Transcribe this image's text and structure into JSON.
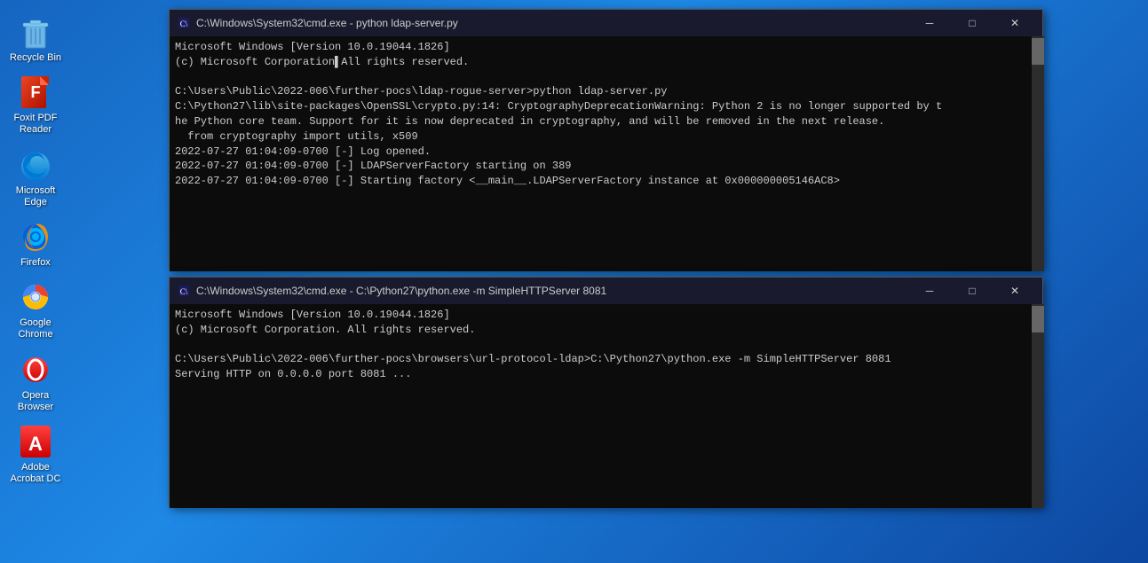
{
  "desktop": {
    "icons": [
      {
        "id": "recycle-bin",
        "label": "Recycle Bin",
        "type": "recycle"
      },
      {
        "id": "foxit-pdf",
        "label": "Foxit PDF\nReader",
        "label_line1": "Foxit PDF",
        "label_line2": "Reader",
        "type": "foxit"
      },
      {
        "id": "microsoft-edge",
        "label": "Microsoft\nEdge",
        "label_line1": "Microsoft",
        "label_line2": "Edge",
        "type": "edge"
      },
      {
        "id": "firefox",
        "label": "Firefox",
        "type": "firefox"
      },
      {
        "id": "google-chrome",
        "label": "Google\nChrome",
        "label_line1": "Google",
        "label_line2": "Chrome",
        "type": "chrome"
      },
      {
        "id": "opera-browser",
        "label": "Opera\nBrowser",
        "label_line1": "Opera",
        "label_line2": "Browser",
        "type": "opera"
      },
      {
        "id": "adobe-acrobat",
        "label": "Adobe\nAcrobat DC",
        "label_line1": "Adobe",
        "label_line2": "Acrobat DC",
        "type": "adobe"
      }
    ]
  },
  "cmd_window1": {
    "title": "C:\\Windows\\System32\\cmd.exe - python  ldap-server.py",
    "lines": [
      "Microsoft Windows [Version 10.0.19044.1826]",
      "(c) Microsoft Corporation. All rights reserved.",
      "",
      "C:\\Users\\Public\\2022-006\\further-pocs\\ldap-rogue-server>python  ldap-server.py",
      "C:\\Python27\\lib\\site-packages\\OpenSSL\\crypto.py:14: CryptographyDeprecationWarning: Python 2 is no longer supported by t",
      "he Python core team. Support for it is now deprecated in cryptography, and will be removed in the next release.",
      "  from cryptography import utils, x509",
      "2022-07-27 01:04:09-0700 [-] Log opened.",
      "2022-07-27 01:04:09-0700 [-] LDAPServerFactory starting on 389",
      "2022-07-27 01:04:09-0700 [-] Starting factory <__main__.LDAPServerFactory instance at 0x000000005146AC8>"
    ],
    "controls": {
      "minimize": "─",
      "maximize": "□",
      "close": "✕"
    }
  },
  "cmd_window2": {
    "title": "C:\\Windows\\System32\\cmd.exe - C:\\Python27\\python.exe -m SimpleHTTPServer 8081",
    "lines": [
      "Microsoft Windows [Version 10.0.19044.1826]",
      "(c) Microsoft Corporation. All rights reserved.",
      "",
      "C:\\Users\\Public\\2022-006\\further-pocs\\browsers\\url-protocol-ldap>C:\\Python27\\python.exe -m SimpleHTTPServer 8081",
      "Serving HTTP on 0.0.0.0 port 8081 ..."
    ],
    "controls": {
      "minimize": "─",
      "maximize": "□",
      "close": "✕"
    }
  }
}
